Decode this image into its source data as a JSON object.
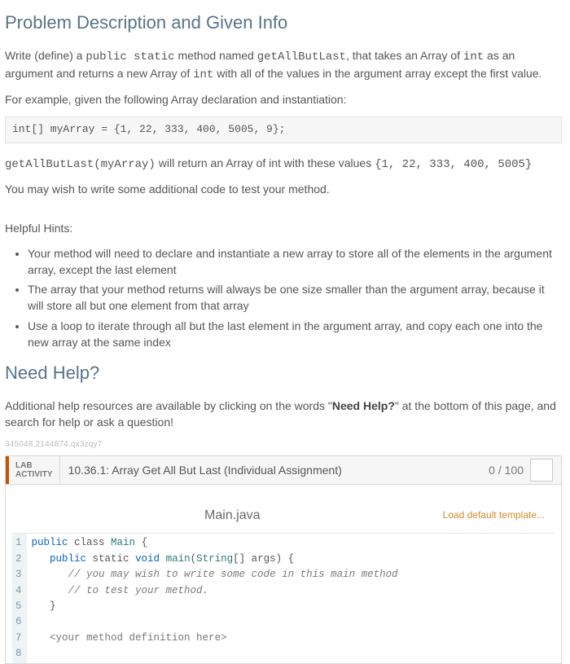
{
  "heading": "Problem Description and Given Info",
  "p1_a": "Write (define) a ",
  "p1_c1": "public static",
  "p1_b": " method named ",
  "p1_c2": "getAllButLast",
  "p1_c": ", that takes an Array of ",
  "p1_c3": "int",
  "p1_d": " as an argument and returns a new Array of ",
  "p1_c4": "int",
  "p1_e": " with all of the values in the argument array except the first value.",
  "p2": "For example, given the following Array declaration and instantiation:",
  "codeblock": "int[] myArray = {1, 22, 333, 400, 5005, 9};",
  "p3_c1": "getAllButLast(myArray)",
  "p3_a": " will return an Array of int with these values ",
  "p3_c2": "{1, 22, 333, 400, 5005}",
  "p4": "You may wish to write some additional code to test your method.",
  "hints_heading": "Helpful Hints:",
  "hints": {
    "h1": "Your method will need to declare and instantiate a new array to store all of the elements in the argument array, except the last element",
    "h2": "The array that your method returns will always be one size smaller than the argument array, because it will store all but one element from that array",
    "h3": "Use a loop to iterate through all but the last element in the argument array, and copy each one into the new array at the same index"
  },
  "need_help_heading": "Need Help?",
  "help_a": "Additional help resources are available by clicking on the words \"",
  "help_bold": "Need Help?",
  "help_b": "\" at the bottom of this page, and search for help or ask a question!",
  "watermark": "345048.2144874.qx3zqy7",
  "lab": {
    "badge1": "LAB",
    "badge2": "ACTIVITY",
    "title": "10.36.1: Array Get All But Last (Individual Assignment)",
    "score": "0 / 100",
    "filename": "Main.java",
    "template_link": "Load default template..."
  },
  "gutter": "1\n2\n3\n4\n5\n6\n7\n8",
  "code": {
    "l1a": "public",
    "l1b": " class ",
    "l1c": "Main",
    "l1d": " {",
    "l2a": "   public",
    "l2b": " static ",
    "l2c": "void",
    "l2d": " ",
    "l2e": "main",
    "l2f": "(",
    "l2g": "String",
    "l2h": "[] args) {",
    "l3": "      // you may wish to write some code in this main method",
    "l4": "      // to test your method.",
    "l5": "   }",
    "l6": "",
    "l7a": "   <",
    "l7b": "your method definition here",
    "l7c": ">",
    "l8": ""
  }
}
